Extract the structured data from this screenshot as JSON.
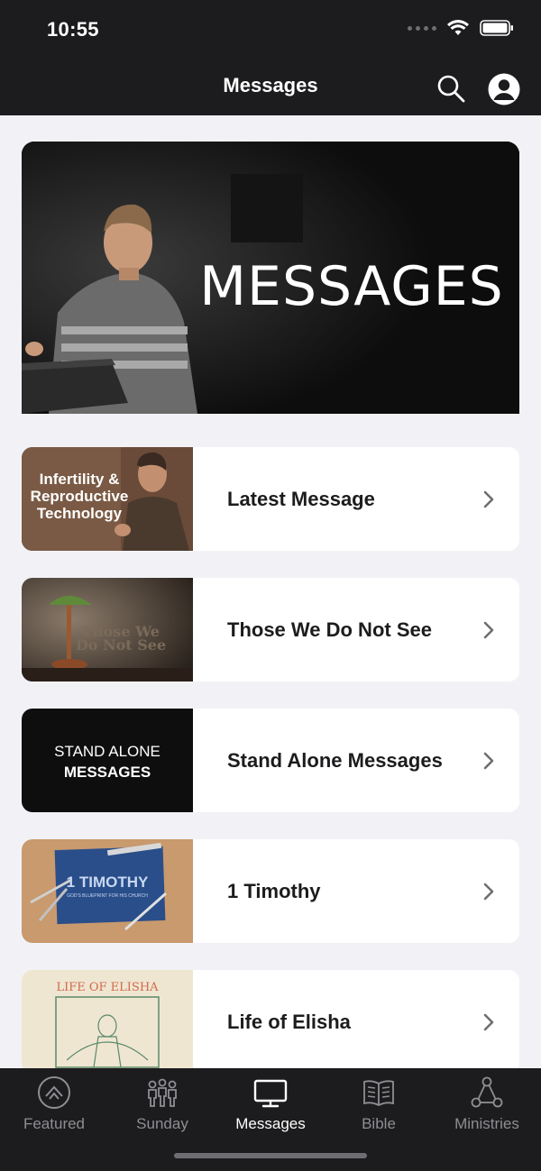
{
  "status_bar": {
    "time": "10:55"
  },
  "header": {
    "title": "Messages",
    "search_icon": "search-icon",
    "profile_icon": "profile-icon"
  },
  "hero": {
    "text": "MESSAGES"
  },
  "series": [
    {
      "label": "Latest Message",
      "thumb_text": [
        "Infertility &",
        "Reproductive",
        "Technology"
      ]
    },
    {
      "label": "Those We Do Not See",
      "thumb_text": [
        "Those We",
        "Do Not See"
      ]
    },
    {
      "label": "Stand Alone Messages",
      "thumb_text": [
        "STAND ALONE",
        "MESSAGES"
      ]
    },
    {
      "label": "1 Timothy",
      "thumb_text": [
        "1 TIMOTHY",
        "GOD'S BLUEPRINT FOR HIS CHURCH"
      ]
    },
    {
      "label": "Life of Elisha",
      "thumb_text": [
        "LIFE OF ELISHA"
      ]
    }
  ],
  "tabs": [
    {
      "label": "Featured",
      "icon": "featured-icon"
    },
    {
      "label": "Sunday",
      "icon": "people-icon"
    },
    {
      "label": "Messages",
      "icon": "monitor-icon",
      "active": true
    },
    {
      "label": "Bible",
      "icon": "book-icon"
    },
    {
      "label": "Ministries",
      "icon": "network-icon"
    }
  ],
  "colors": {
    "bar_bg": "#1c1c1e",
    "page_bg": "#f2f2f6",
    "active_tab": "#ffffff",
    "inactive_tab": "#8e8e93"
  }
}
